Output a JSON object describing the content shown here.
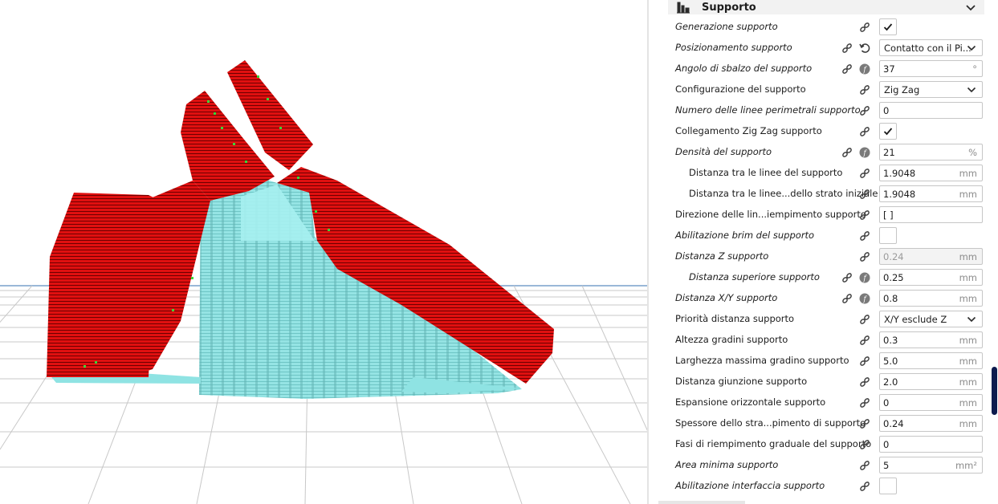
{
  "section": {
    "title": "Supporto",
    "icon": "support-icon"
  },
  "settings": [
    {
      "label": "Generazione supporto",
      "italic": true,
      "indent": false,
      "type": "check",
      "checked": true,
      "reset": false,
      "func": false
    },
    {
      "label": "Posizionamento supporto",
      "italic": true,
      "indent": false,
      "type": "select",
      "value": "Contatto con il Pi...",
      "reset": true,
      "func": false
    },
    {
      "label": "Angolo di sbalzo del supporto",
      "italic": true,
      "indent": false,
      "type": "text",
      "value": "37",
      "unit": "°",
      "reset": false,
      "func": true
    },
    {
      "label": "Configurazione del supporto",
      "italic": false,
      "indent": false,
      "type": "select",
      "value": "Zig Zag",
      "reset": false,
      "func": false
    },
    {
      "label": "Numero delle linee perimetrali supporto",
      "italic": true,
      "indent": false,
      "type": "text",
      "value": "0",
      "unit": "",
      "reset": false,
      "func": false
    },
    {
      "label": "Collegamento Zig Zag supporto",
      "italic": false,
      "indent": false,
      "type": "check",
      "checked": true,
      "reset": false,
      "func": false
    },
    {
      "label": "Densità del supporto",
      "italic": true,
      "indent": false,
      "type": "text",
      "value": "21",
      "unit": "%",
      "reset": false,
      "func": true
    },
    {
      "label": "Distanza tra le linee del supporto",
      "italic": false,
      "indent": true,
      "type": "text",
      "value": "1.9048",
      "unit": "mm",
      "reset": false,
      "func": false
    },
    {
      "label": "Distanza tra le linee...dello strato iniziale",
      "italic": false,
      "indent": true,
      "type": "text",
      "value": "1.9048",
      "unit": "mm",
      "reset": false,
      "func": false
    },
    {
      "label": "Direzione delle lin...iempimento supporto",
      "italic": false,
      "indent": false,
      "type": "text",
      "value": "[ ]",
      "unit": "",
      "reset": false,
      "func": false
    },
    {
      "label": "Abilitazione brim del supporto",
      "italic": true,
      "indent": false,
      "type": "check",
      "checked": false,
      "reset": false,
      "func": false
    },
    {
      "label": "Distanza Z supporto",
      "italic": true,
      "indent": false,
      "type": "text",
      "value": "0.24",
      "unit": "mm",
      "disabled": true,
      "reset": false,
      "func": false
    },
    {
      "label": "Distanza superiore supporto",
      "italic": true,
      "indent": true,
      "type": "text",
      "value": "0.25",
      "unit": "mm",
      "reset": false,
      "func": true
    },
    {
      "label": "Distanza X/Y supporto",
      "italic": true,
      "indent": false,
      "type": "text",
      "value": "0.8",
      "unit": "mm",
      "reset": false,
      "func": true
    },
    {
      "label": "Priorità distanza supporto",
      "italic": false,
      "indent": false,
      "type": "select",
      "value": "X/Y esclude Z",
      "reset": false,
      "func": false
    },
    {
      "label": "Altezza gradini supporto",
      "italic": false,
      "indent": false,
      "type": "text",
      "value": "0.3",
      "unit": "mm",
      "reset": false,
      "func": false
    },
    {
      "label": "Larghezza massima gradino supporto",
      "italic": false,
      "indent": false,
      "type": "text",
      "value": "5.0",
      "unit": "mm",
      "reset": false,
      "func": false
    },
    {
      "label": "Distanza giunzione supporto",
      "italic": false,
      "indent": false,
      "type": "text",
      "value": "2.0",
      "unit": "mm",
      "reset": false,
      "func": false
    },
    {
      "label": "Espansione orizzontale supporto",
      "italic": false,
      "indent": false,
      "type": "text",
      "value": "0",
      "unit": "mm",
      "reset": false,
      "func": false
    },
    {
      "label": "Spessore dello stra...pimento di supporto",
      "italic": false,
      "indent": false,
      "type": "text",
      "value": "0.24",
      "unit": "mm",
      "reset": false,
      "func": false
    },
    {
      "label": "Fasi di riempimento graduale del supporto",
      "italic": false,
      "indent": false,
      "type": "text",
      "value": "0",
      "unit": "",
      "reset": false,
      "func": false
    },
    {
      "label": "Area minima supporto",
      "italic": true,
      "indent": false,
      "type": "text",
      "value": "5",
      "unit": "mm²",
      "reset": false,
      "func": false
    },
    {
      "label": "Abilitazione interfaccia supporto",
      "italic": true,
      "indent": false,
      "type": "check",
      "checked": false,
      "reset": false,
      "func": false
    }
  ],
  "colors": {
    "model": "#e01010",
    "support": "#8fe3e3",
    "grid": "#c8c8c8",
    "scrollbar": "#0d1b4e"
  }
}
